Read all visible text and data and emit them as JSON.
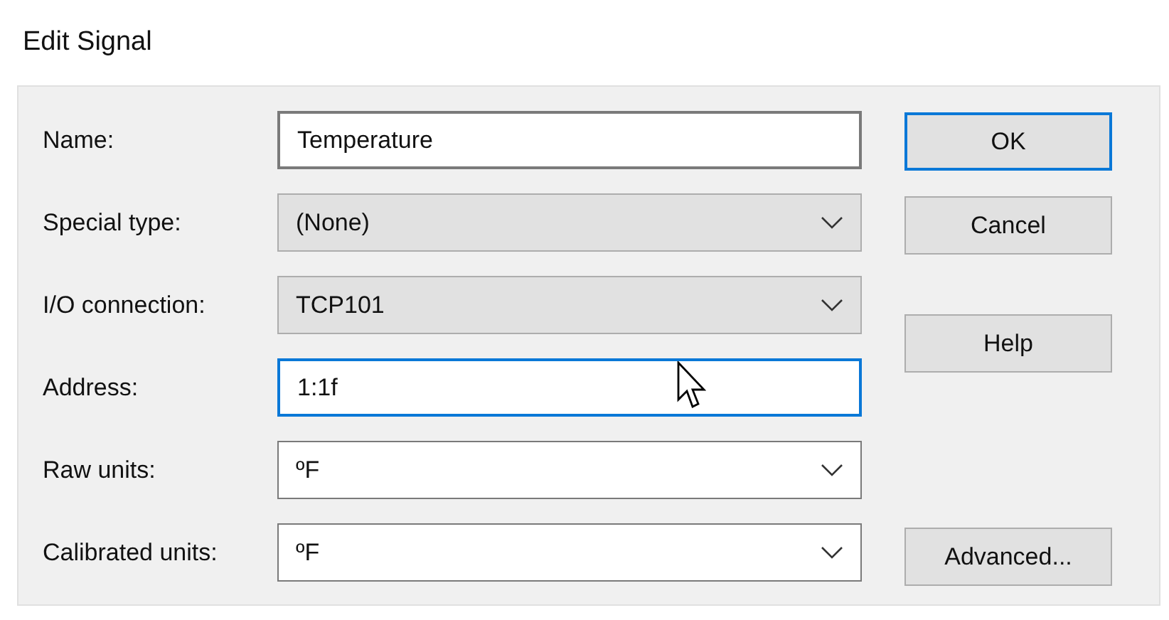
{
  "window": {
    "title": "Edit Signal"
  },
  "fields": [
    {
      "label": "Name:",
      "kind": "text",
      "value": "Temperature",
      "focused": false
    },
    {
      "label": "Special type:",
      "kind": "combo",
      "value": "(None)",
      "editable": false
    },
    {
      "label": "I/O connection:",
      "kind": "combo",
      "value": "TCP101",
      "editable": false
    },
    {
      "label": "Address:",
      "kind": "text",
      "value": "1:1f",
      "focused": true
    },
    {
      "label": "Raw units:",
      "kind": "combo",
      "value": "ºF",
      "editable": true
    },
    {
      "label": "Calibrated units:",
      "kind": "combo",
      "value": "ºF",
      "editable": true
    }
  ],
  "buttons": [
    {
      "label": "OK",
      "default": true
    },
    {
      "label": "Cancel",
      "default": false
    },
    {
      "label": "Help",
      "default": false
    },
    {
      "label": "Advanced...",
      "default": false
    }
  ]
}
